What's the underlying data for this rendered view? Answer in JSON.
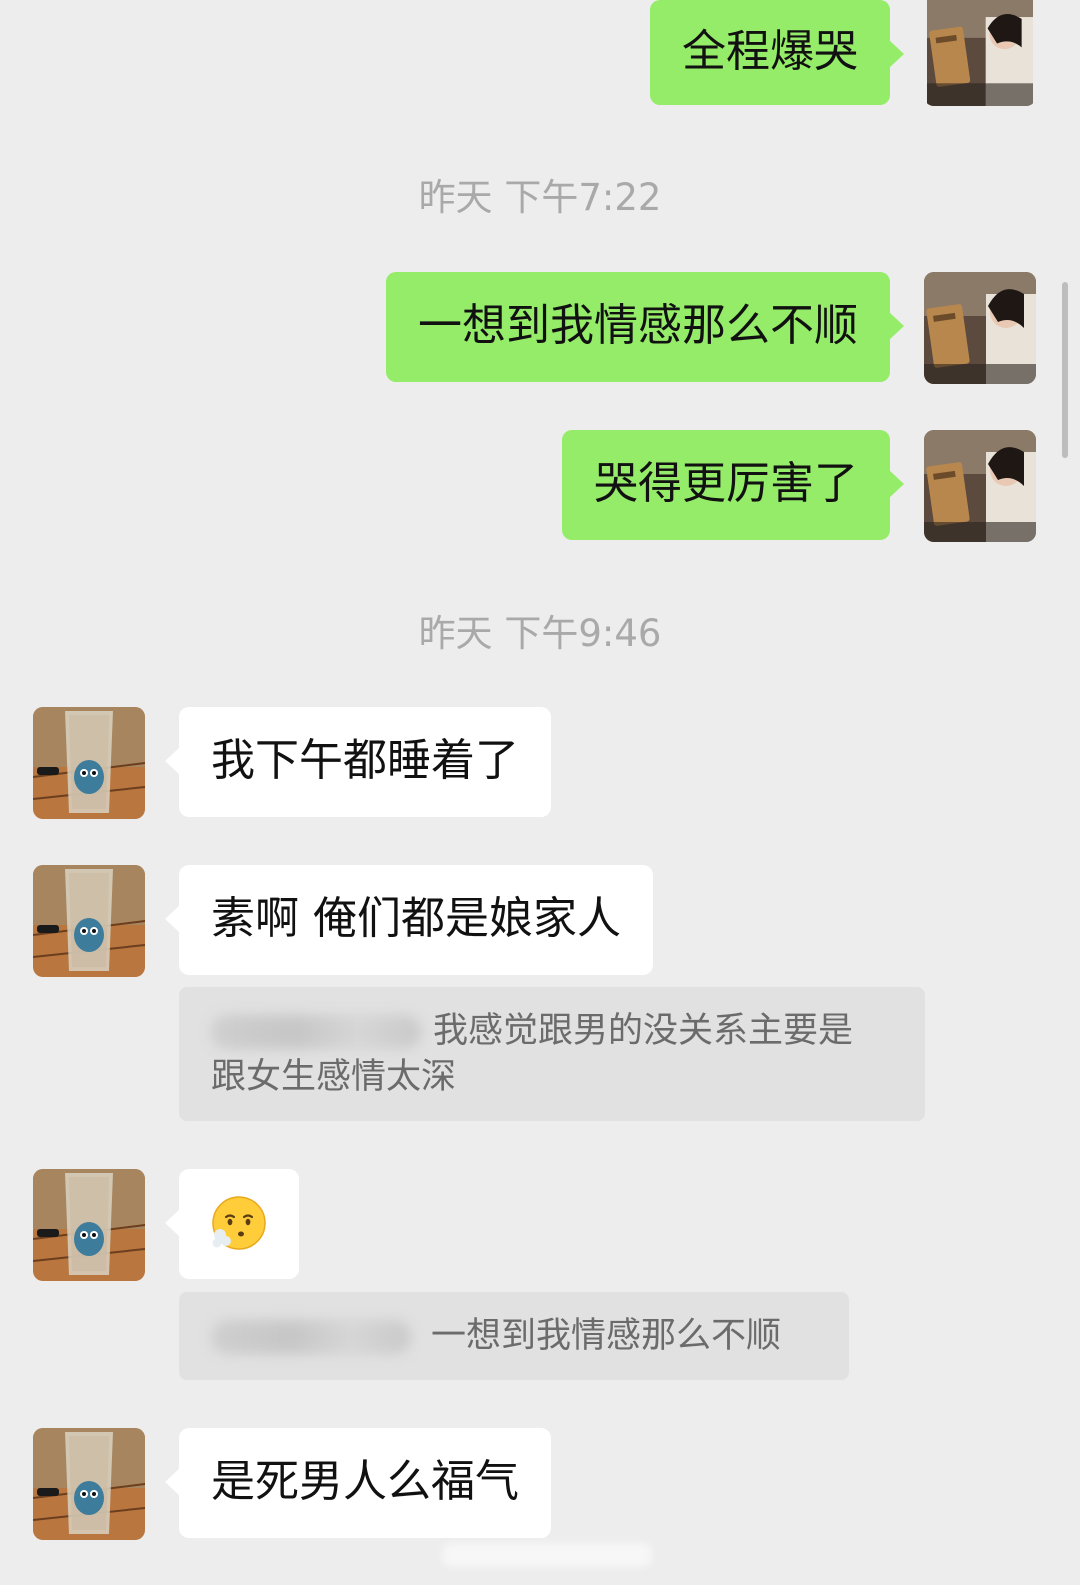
{
  "messages": [
    {
      "from": "me",
      "text": "全程爆哭"
    },
    {
      "timestamp": "昨天 下午7:22"
    },
    {
      "from": "me",
      "text": "一想到我情感那么不顺"
    },
    {
      "from": "me",
      "text": "哭得更厉害了"
    },
    {
      "timestamp": "昨天 下午9:46"
    },
    {
      "from": "them",
      "text": "我下午都睡着了"
    },
    {
      "from": "them",
      "text": "素啊 俺们都是娘家人"
    },
    {
      "quote": "我感觉跟男的没关系主要是跟女生感情太深",
      "quote_line1": "我感觉跟男的没关系主要是",
      "quote_line2": "跟女生感情太深"
    },
    {
      "from": "them",
      "emoji": "face-exhaling-emoji"
    },
    {
      "quote": "一想到我情感那么不顺"
    },
    {
      "from": "them",
      "text": "是死男人么福气"
    }
  ],
  "colors": {
    "background": "#ededed",
    "my_bubble": "#95ec69",
    "their_bubble": "#ffffff",
    "quote_background": "#e1e1e1",
    "timestamp_text": "#a9a9a9"
  },
  "avatars": {
    "me": "avatar-woman-reading-icon",
    "them": "avatar-glass-cup-icon"
  }
}
